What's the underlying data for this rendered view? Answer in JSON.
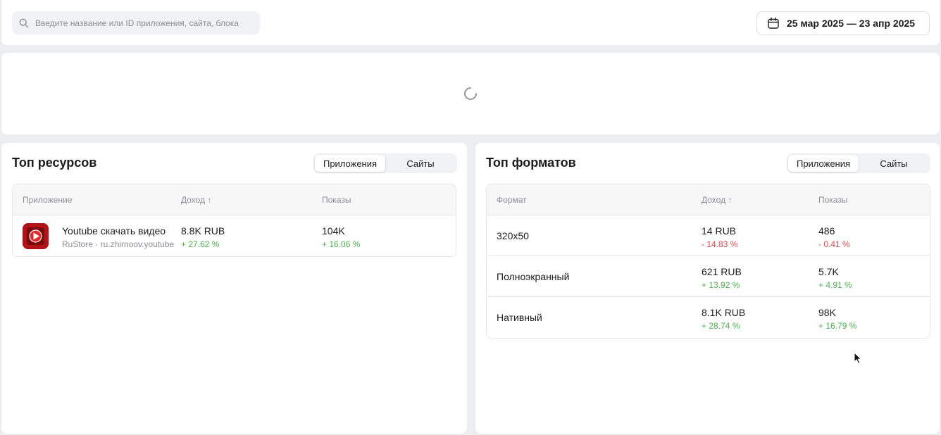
{
  "search": {
    "placeholder": "Введите название или ID приложения, сайта, блока"
  },
  "date_range": {
    "label": "25 мар 2025 — 23 апр 2025"
  },
  "top_resources": {
    "title": "Топ ресурсов",
    "tabs": [
      {
        "label": "Приложения",
        "active": true
      },
      {
        "label": "Сайты",
        "active": false
      }
    ],
    "columns": {
      "name": "Приложение",
      "revenue": "Доход ↑",
      "impressions": "Показы"
    },
    "rows": [
      {
        "name": "Youtube скачать видео",
        "subtitle": "RuStore · ru.zhirnoov.youtube",
        "revenue": "8.8K RUB",
        "revenue_delta": "+ 27.62 %",
        "impressions": "104K",
        "impressions_delta": "+ 16.06 %"
      }
    ]
  },
  "top_formats": {
    "title": "Топ форматов",
    "tabs": [
      {
        "label": "Приложения",
        "active": true
      },
      {
        "label": "Сайты",
        "active": false
      }
    ],
    "columns": {
      "name": "Формат",
      "revenue": "Доход ↑",
      "impressions": "Показы"
    },
    "rows": [
      {
        "name": "320x50",
        "revenue": "14 RUB",
        "revenue_delta": "- 14.83 %",
        "revenue_trend": "down",
        "impressions": "486",
        "impressions_delta": "- 0.41 %",
        "impressions_trend": "down"
      },
      {
        "name": "Полноэкранный",
        "revenue": "621 RUB",
        "revenue_delta": "+ 13.92 %",
        "revenue_trend": "up",
        "impressions": "5.7K",
        "impressions_delta": "+ 4.91 %",
        "impressions_trend": "up"
      },
      {
        "name": "Нативный",
        "revenue": "8.1K RUB",
        "revenue_delta": "+ 28.74 %",
        "revenue_trend": "up",
        "impressions": "98K",
        "impressions_delta": "+ 16.79 %",
        "impressions_trend": "up"
      }
    ]
  },
  "colors": {
    "positive": "#4bb34b",
    "negative": "#e64646",
    "background": "#ebedf0"
  },
  "icons": [
    "search-icon",
    "calendar-icon",
    "loading-spinner-icon",
    "youtube-app-icon"
  ]
}
